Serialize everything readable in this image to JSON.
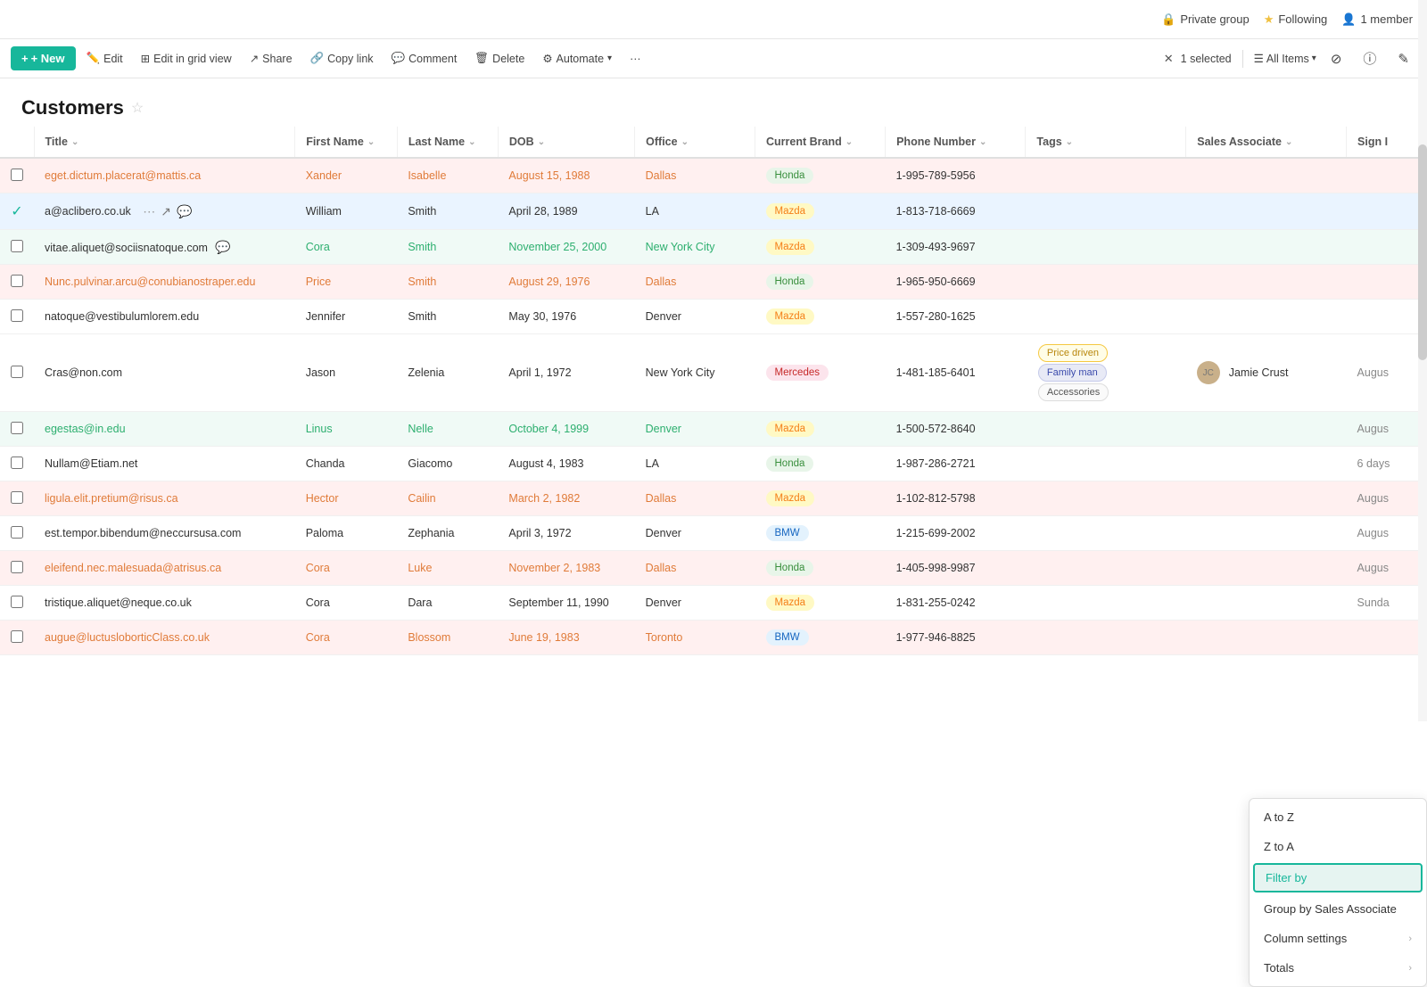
{
  "topbar": {
    "private_group_label": "Private group",
    "following_label": "Following",
    "member_label": "1 member"
  },
  "toolbar": {
    "new_label": "+ New",
    "edit_label": "Edit",
    "grid_label": "Edit in grid view",
    "share_label": "Share",
    "copy_label": "Copy link",
    "comment_label": "Comment",
    "delete_label": "Delete",
    "automate_label": "Automate",
    "more_label": "···",
    "selected_label": "1 selected",
    "all_items_label": "All Items",
    "filter_icon": "⊘",
    "info_icon": "ⓘ",
    "edit2_icon": "✎"
  },
  "page": {
    "title": "Customers"
  },
  "columns": [
    {
      "key": "title",
      "label": "Title"
    },
    {
      "key": "fname",
      "label": "First Name"
    },
    {
      "key": "lname",
      "label": "Last Name"
    },
    {
      "key": "dob",
      "label": "DOB"
    },
    {
      "key": "office",
      "label": "Office"
    },
    {
      "key": "brand",
      "label": "Current Brand"
    },
    {
      "key": "phone",
      "label": "Phone Number"
    },
    {
      "key": "tags",
      "label": "Tags"
    },
    {
      "key": "sales",
      "label": "Sales Associate"
    },
    {
      "key": "sign",
      "label": "Sign I"
    }
  ],
  "rows": [
    {
      "id": 1,
      "rowClass": "row-pink",
      "checked": false,
      "title": "eget.dictum.placerat@mattis.ca",
      "titleColor": "orange",
      "fname": "Xander",
      "fnameColor": "orange",
      "lname": "Isabelle",
      "lnameColor": "orange",
      "dob": "August 15, 1988",
      "dobColor": "orange",
      "office": "Dallas",
      "officeColor": "orange",
      "brand": "Honda",
      "brandClass": "brand-honda",
      "phone": "1-995-789-5956",
      "tags": [],
      "sales": "",
      "sign": ""
    },
    {
      "id": 2,
      "rowClass": "row-selected",
      "checked": true,
      "title": "a@aclibero.co.uk",
      "titleColor": "normal",
      "fname": "William",
      "fnameColor": "normal",
      "lname": "Smith",
      "lnameColor": "normal",
      "dob": "April 28, 1989",
      "dobColor": "normal",
      "office": "LA",
      "officeColor": "normal",
      "brand": "Mazda",
      "brandClass": "brand-mazda",
      "phone": "1-813-718-6669",
      "tags": [],
      "sales": "",
      "sign": "",
      "hasActions": true
    },
    {
      "id": 3,
      "rowClass": "row-green",
      "checked": false,
      "title": "vitae.aliquet@sociisnatoque.com",
      "titleColor": "normal",
      "fname": "Cora",
      "fnameColor": "green",
      "lname": "Smith",
      "lnameColor": "green",
      "dob": "November 25, 2000",
      "dobColor": "green",
      "office": "New York City",
      "officeColor": "green",
      "brand": "Mazda",
      "brandClass": "brand-mazda",
      "phone": "1-309-493-9697",
      "tags": [],
      "sales": "",
      "sign": "",
      "hasComment": true
    },
    {
      "id": 4,
      "rowClass": "row-pink",
      "checked": false,
      "title": "Nunc.pulvinar.arcu@conubianostraper.edu",
      "titleColor": "orange",
      "fname": "Price",
      "fnameColor": "orange",
      "lname": "Smith",
      "lnameColor": "orange",
      "dob": "August 29, 1976",
      "dobColor": "orange",
      "office": "Dallas",
      "officeColor": "orange",
      "brand": "Honda",
      "brandClass": "brand-honda",
      "phone": "1-965-950-6669",
      "tags": [],
      "sales": "",
      "sign": ""
    },
    {
      "id": 5,
      "rowClass": "row-white",
      "checked": false,
      "title": "natoque@vestibulumlorem.edu",
      "titleColor": "normal",
      "fname": "Jennifer",
      "fnameColor": "normal",
      "lname": "Smith",
      "lnameColor": "normal",
      "dob": "May 30, 1976",
      "dobColor": "normal",
      "office": "Denver",
      "officeColor": "normal",
      "brand": "Mazda",
      "brandClass": "brand-mazda",
      "phone": "1-557-280-1625",
      "tags": [],
      "sales": "",
      "sign": ""
    },
    {
      "id": 6,
      "rowClass": "row-white",
      "checked": false,
      "title": "Cras@non.com",
      "titleColor": "normal",
      "fname": "Jason",
      "fnameColor": "normal",
      "lname": "Zelenia",
      "lnameColor": "normal",
      "dob": "April 1, 1972",
      "dobColor": "normal",
      "office": "New York City",
      "officeColor": "normal",
      "brand": "Mercedes",
      "brandClass": "brand-mercedes",
      "phone": "1-481-185-6401",
      "tags": [
        "Price driven",
        "Family man",
        "Accessories"
      ],
      "sales": "Jamie Crust",
      "sign": "Augus"
    },
    {
      "id": 7,
      "rowClass": "row-green",
      "checked": false,
      "title": "egestas@in.edu",
      "titleColor": "green",
      "fname": "Linus",
      "fnameColor": "green",
      "lname": "Nelle",
      "lnameColor": "green",
      "dob": "October 4, 1999",
      "dobColor": "green",
      "office": "Denver",
      "officeColor": "green",
      "brand": "Mazda",
      "brandClass": "brand-mazda",
      "phone": "1-500-572-8640",
      "tags": [],
      "sales": "",
      "sign": "Augus"
    },
    {
      "id": 8,
      "rowClass": "row-white",
      "checked": false,
      "title": "Nullam@Etiam.net",
      "titleColor": "normal",
      "fname": "Chanda",
      "fnameColor": "normal",
      "lname": "Giacomo",
      "lnameColor": "normal",
      "dob": "August 4, 1983",
      "dobColor": "normal",
      "office": "LA",
      "officeColor": "normal",
      "brand": "Honda",
      "brandClass": "brand-honda",
      "phone": "1-987-286-2721",
      "tags": [],
      "sales": "",
      "sign": "6 days"
    },
    {
      "id": 9,
      "rowClass": "row-pink",
      "checked": false,
      "title": "ligula.elit.pretium@risus.ca",
      "titleColor": "orange",
      "fname": "Hector",
      "fnameColor": "orange",
      "lname": "Cailin",
      "lnameColor": "orange",
      "dob": "March 2, 1982",
      "dobColor": "orange",
      "office": "Dallas",
      "officeColor": "orange",
      "brand": "Mazda",
      "brandClass": "brand-mazda",
      "phone": "1-102-812-5798",
      "tags": [],
      "sales": "",
      "sign": "Augus"
    },
    {
      "id": 10,
      "rowClass": "row-white",
      "checked": false,
      "title": "est.tempor.bibendum@neccursusa.com",
      "titleColor": "normal",
      "fname": "Paloma",
      "fnameColor": "normal",
      "lname": "Zephania",
      "lnameColor": "normal",
      "dob": "April 3, 1972",
      "dobColor": "normal",
      "office": "Denver",
      "officeColor": "normal",
      "brand": "BMW",
      "brandClass": "brand-bmw",
      "phone": "1-215-699-2002",
      "tags": [],
      "sales": "",
      "sign": "Augus"
    },
    {
      "id": 11,
      "rowClass": "row-pink",
      "checked": false,
      "title": "eleifend.nec.malesuada@atrisus.ca",
      "titleColor": "orange",
      "fname": "Cora",
      "fnameColor": "orange",
      "lname": "Luke",
      "lnameColor": "orange",
      "dob": "November 2, 1983",
      "dobColor": "orange",
      "office": "Dallas",
      "officeColor": "orange",
      "brand": "Honda",
      "brandClass": "brand-honda",
      "phone": "1-405-998-9987",
      "tags": [],
      "sales": "",
      "sign": "Augus"
    },
    {
      "id": 12,
      "rowClass": "row-white",
      "checked": false,
      "title": "tristique.aliquet@neque.co.uk",
      "titleColor": "normal",
      "fname": "Cora",
      "fnameColor": "normal",
      "lname": "Dara",
      "lnameColor": "normal",
      "dob": "September 11, 1990",
      "dobColor": "normal",
      "office": "Denver",
      "officeColor": "normal",
      "brand": "Mazda",
      "brandClass": "brand-mazda",
      "phone": "1-831-255-0242",
      "tags": [],
      "sales": "",
      "sign": "Sunda"
    },
    {
      "id": 13,
      "rowClass": "row-pink",
      "checked": false,
      "title": "augue@luctusloborticClass.co.uk",
      "titleColor": "orange",
      "fname": "Cora",
      "fnameColor": "orange",
      "lname": "Blossom",
      "lnameColor": "orange",
      "dob": "June 19, 1983",
      "dobColor": "orange",
      "office": "Toronto",
      "officeColor": "orange",
      "brand": "BMW",
      "brandClass": "brand-bmw",
      "phone": "1-977-946-8825",
      "tags": [],
      "sales": "",
      "sign": ""
    }
  ],
  "dropdown": {
    "items": [
      {
        "label": "A to Z",
        "active": false,
        "hasArrow": false
      },
      {
        "label": "Z to A",
        "active": false,
        "hasArrow": false
      },
      {
        "label": "Filter by",
        "active": true,
        "hasArrow": false
      },
      {
        "label": "Group by Sales Associate",
        "active": false,
        "hasArrow": false
      },
      {
        "label": "Column settings",
        "active": false,
        "hasArrow": true
      },
      {
        "label": "Totals",
        "active": false,
        "hasArrow": true
      }
    ]
  }
}
